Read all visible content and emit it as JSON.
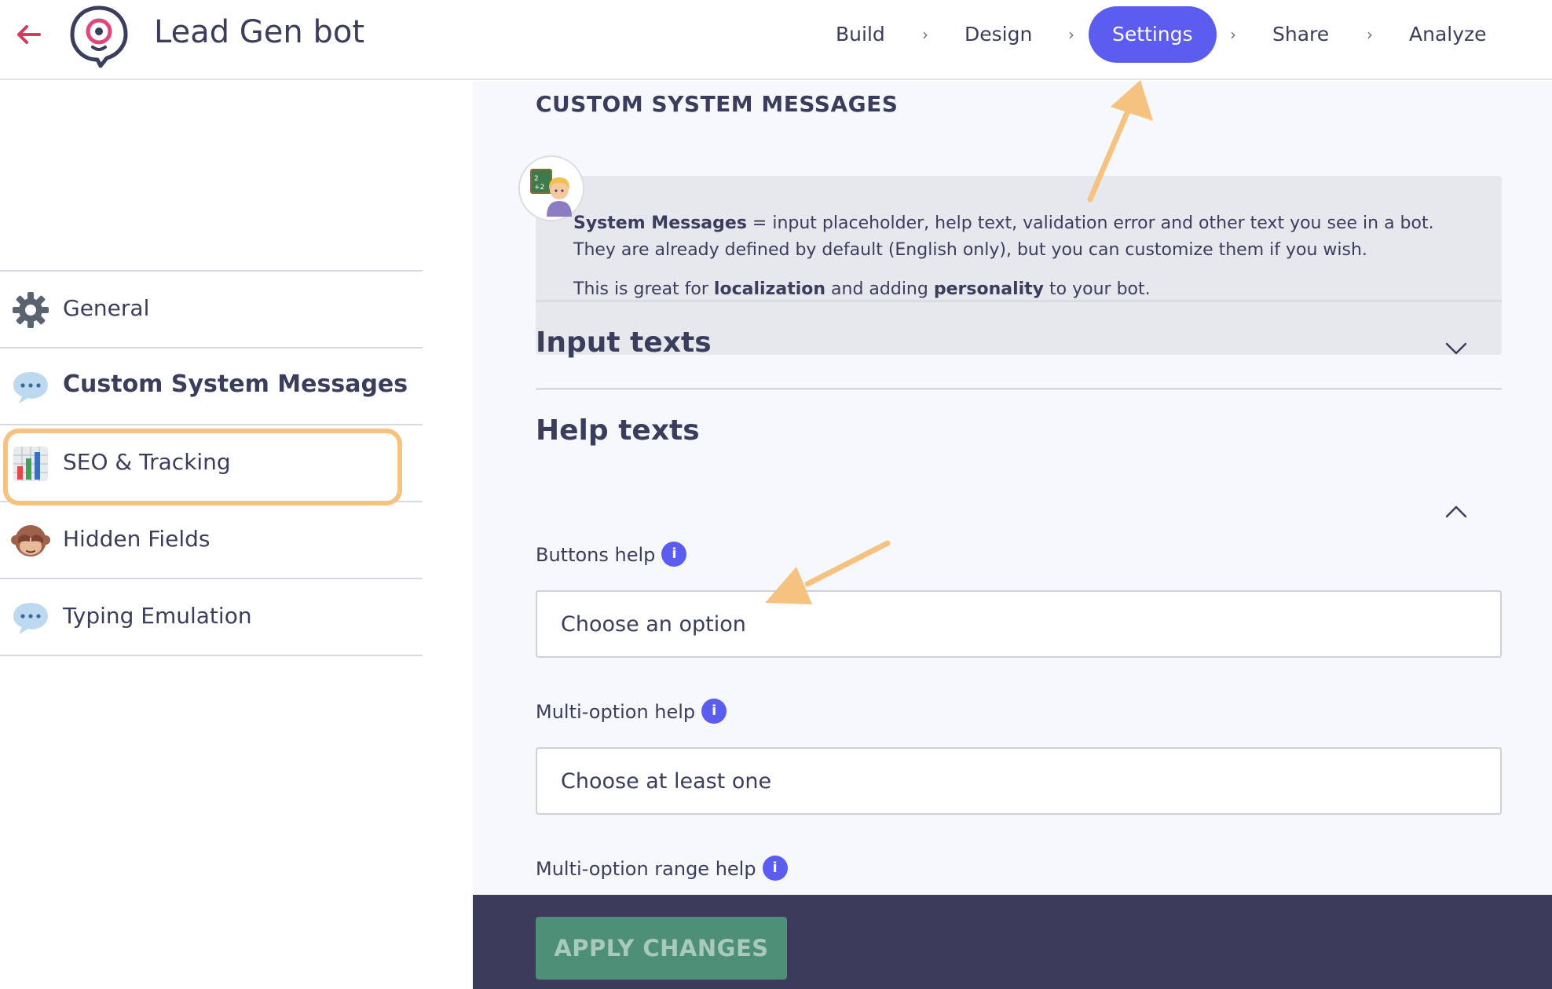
{
  "header": {
    "app_title": "Lead Gen bot",
    "steps": [
      "Build",
      "Design",
      "Settings",
      "Share",
      "Analyze"
    ],
    "separator": "›",
    "active_step": "Settings",
    "accent_color": "#5b5cf0",
    "back_color": "#d23a5e"
  },
  "sidebar": {
    "items": [
      {
        "label": "General",
        "icon": "gear-icon"
      },
      {
        "label": "Custom System Messages",
        "icon": "speech-bubble-icon"
      },
      {
        "label": "SEO & Tracking",
        "icon": "bar-chart-icon"
      },
      {
        "label": "Hidden Fields",
        "icon": "see-no-evil-monkey-icon"
      },
      {
        "label": "Typing Emulation",
        "icon": "speech-bubble-icon"
      }
    ],
    "active_item": "Custom System Messages",
    "highlight_color": "#f5c27f"
  },
  "main": {
    "section_title": "CUSTOM SYSTEM MESSAGES",
    "info": {
      "p1_bold": "System Messages",
      "p1_rest": " = input placeholder, help text, validation error and other text you see in a bot. They are already defined by default (English only), but you can customize them if you wish.",
      "p2_a": "This is great for ",
      "p2_b": "localization",
      "p2_c": " and adding ",
      "p2_d": "personality",
      "p2_e": " to your bot."
    },
    "accordions": {
      "input_texts": "Input texts",
      "help_texts": "Help texts"
    },
    "fields": {
      "buttons_help_label": "Buttons help",
      "buttons_help_value": "Choose an option",
      "multi_option_label": "Multi-option help",
      "multi_option_value": "Choose at least one",
      "multi_range_label": "Multi-option range help"
    },
    "info_glyph": "i"
  },
  "footer": {
    "apply_label": "APPLY CHANGES",
    "apply_color": "#4e8f77"
  },
  "annotation_color": "#f5c27f"
}
